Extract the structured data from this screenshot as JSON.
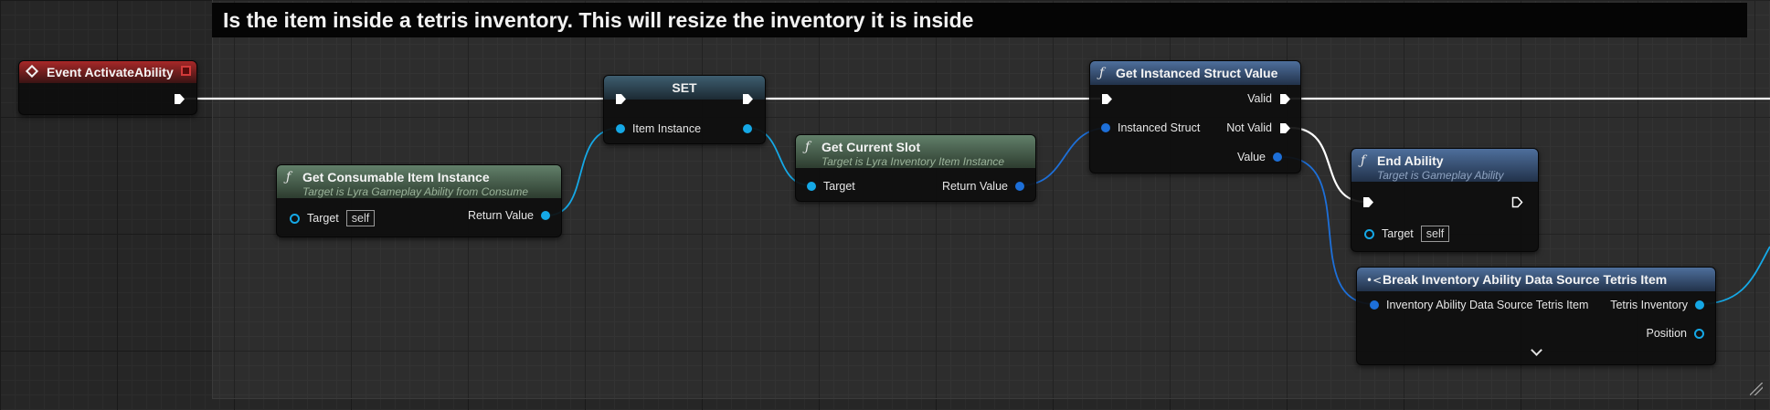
{
  "comment": {
    "title": "Is the item inside a tetris inventory. This will resize the inventory it is inside"
  },
  "event_node": {
    "title": "Event ActivateAbility",
    "icon": "event-diamond-icon"
  },
  "consumable_node": {
    "title": "Get Consumable Item Instance",
    "subtitle": "Target is Lyra Gameplay Ability from Consume",
    "target_label": "Target",
    "target_default": "self",
    "return_label": "Return Value"
  },
  "set_node": {
    "title": "SET",
    "pin_label": "Item Instance"
  },
  "current_slot_node": {
    "title": "Get Current Slot",
    "subtitle": "Target is Lyra Inventory Item Instance",
    "target_label": "Target",
    "return_label": "Return Value"
  },
  "struct_node": {
    "title": "Get Instanced Struct Value",
    "input_label": "Instanced Struct",
    "valid_label": "Valid",
    "not_valid_label": "Not Valid",
    "value_label": "Value"
  },
  "end_ability_node": {
    "title": "End Ability",
    "subtitle": "Target is Gameplay Ability",
    "target_label": "Target",
    "target_default": "self"
  },
  "break_node": {
    "title": "Break Inventory Ability Data Source Tetris Item",
    "input_label": "Inventory Ability Data Source Tetris Item",
    "tetris_label": "Tetris Inventory",
    "position_label": "Position"
  },
  "colors": {
    "object_pin": "#15a8e6",
    "struct_pin": "#1d6fd8",
    "exec_wire": "#ffffff",
    "pure_header": "#62806a",
    "func_header": "#4e6f9c",
    "event_header": "#a82828"
  }
}
